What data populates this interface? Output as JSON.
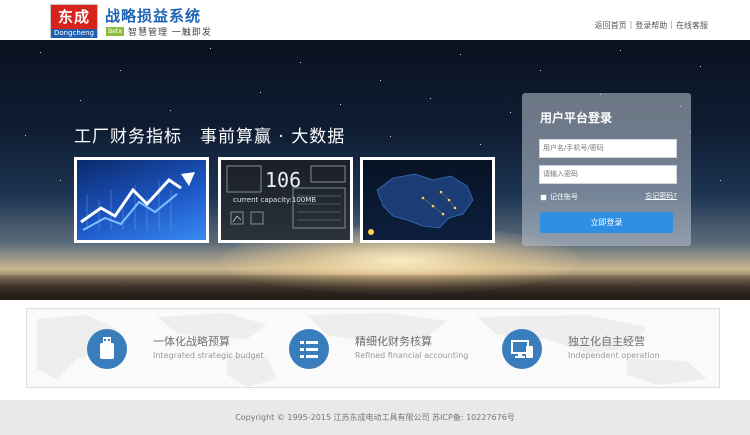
{
  "header": {
    "logo_text": "东成",
    "logo_subtext": "Dongcheng",
    "app_title": "战略损益系统",
    "badge": "Beta",
    "slogan": "智慧管理 一触即发",
    "links": [
      "返回首页",
      "登录帮助",
      "在线客服"
    ]
  },
  "banner": {
    "headline": "工厂财务指标　事前算赢 · 大数据",
    "thumb2_number": "106",
    "thumb2_caption": "current capacity:100MB"
  },
  "login": {
    "title": "用户平台登录",
    "user_placeholder": "用户名/手机号/密码",
    "password_placeholder": "请输入密码",
    "remember_label": "记住账号",
    "forgot_label": "忘记密码?",
    "submit_label": "立即登录"
  },
  "features": [
    {
      "icon": "usb-drive-icon",
      "title": "一体化战略预算",
      "subtitle": "Integrated strategic budget"
    },
    {
      "icon": "list-checklist-icon",
      "title": "精细化财务核算",
      "subtitle": "Refined financial accounting"
    },
    {
      "icon": "monitor-devices-icon",
      "title": "独立化自主经营",
      "subtitle": "Independent operation"
    }
  ],
  "footer": {
    "copyright": "Copyright © 1995-2015 江苏东成电动工具有限公司 苏ICP备: 10227676号"
  },
  "colors": {
    "brand_red": "#d6231c",
    "brand_blue": "#1f64b4",
    "login_button": "#2f8fe4",
    "feature_icon": "#3a7dbd"
  }
}
